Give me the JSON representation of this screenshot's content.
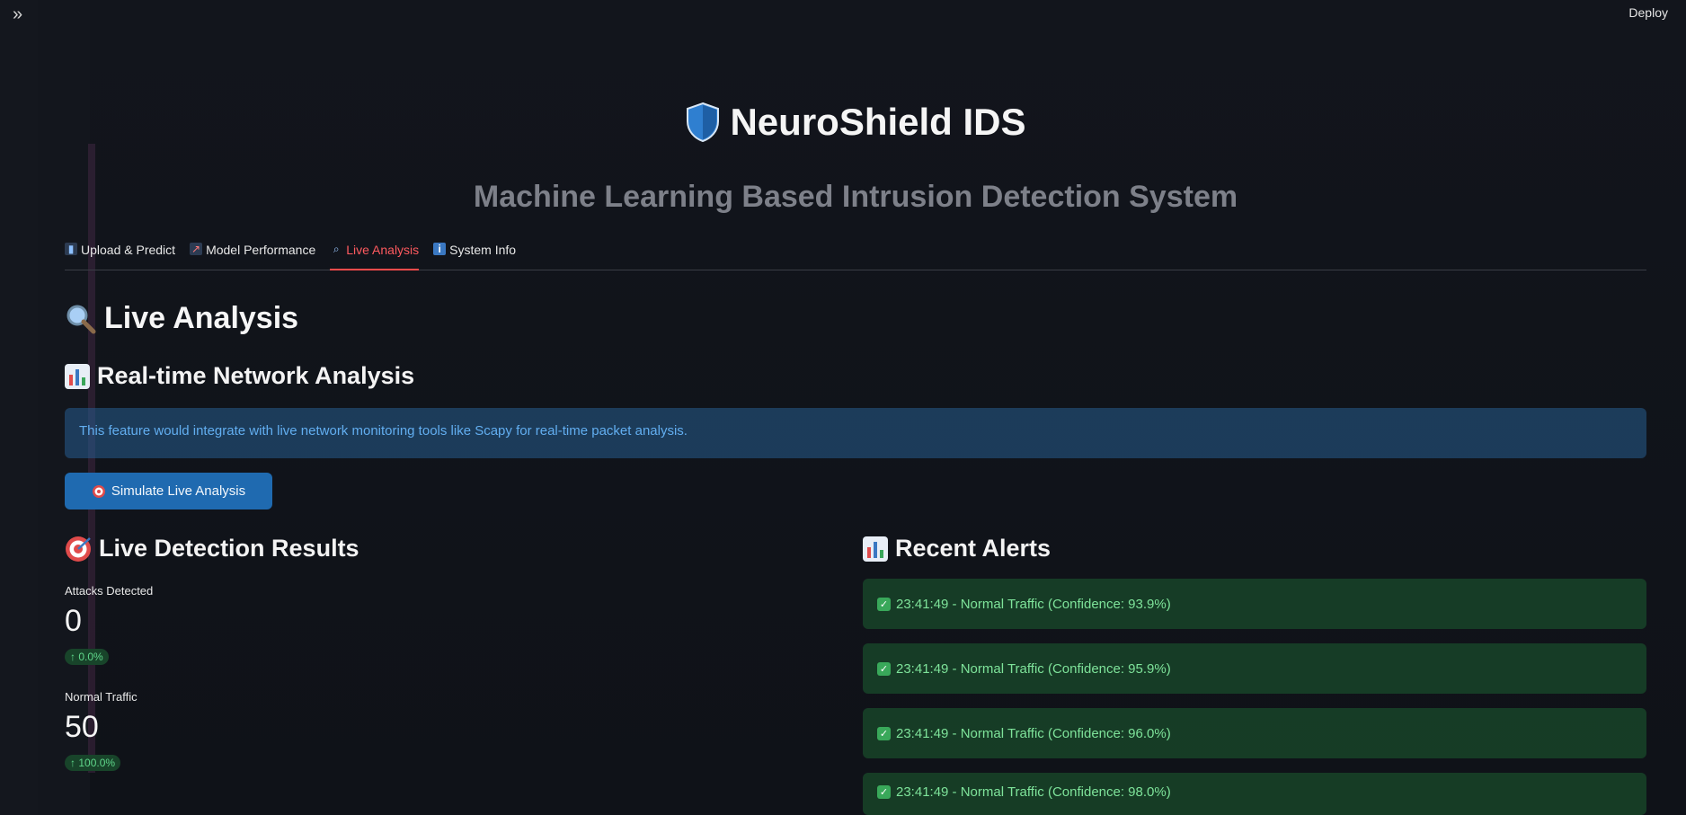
{
  "toolbar": {
    "sidebar_toggle_icon": "double-chevron-right-icon",
    "deploy_label": "Deploy"
  },
  "header": {
    "title": "NeuroShield IDS",
    "subtitle": "Machine Learning Based Intrusion Detection System",
    "title_icon": "shield-icon"
  },
  "tabs": [
    {
      "label": "Upload & Predict",
      "icon": "bar-chart-icon",
      "active": false
    },
    {
      "label": "Model Performance",
      "icon": "line-chart-icon",
      "active": false
    },
    {
      "label": "Live Analysis",
      "icon": "search-icon",
      "active": true
    },
    {
      "label": "System Info",
      "icon": "info-icon",
      "active": false
    }
  ],
  "page": {
    "heading": "Live Analysis",
    "section_realtime": "Real-time Network Analysis",
    "info_text": "This feature would integrate with live network monitoring tools like Scapy for real-time packet analysis.",
    "simulate_button": "Simulate Live Analysis"
  },
  "results": {
    "heading": "Live Detection Results",
    "metrics": [
      {
        "label": "Attacks Detected",
        "value": "0",
        "delta": "0.0%"
      },
      {
        "label": "Normal Traffic",
        "value": "50",
        "delta": "100.0%"
      }
    ]
  },
  "alerts": {
    "heading": "Recent Alerts",
    "items": [
      "23:41:49 - Normal Traffic (Confidence: 93.9%)",
      "23:41:49 - Normal Traffic (Confidence: 95.9%)",
      "23:41:49 - Normal Traffic (Confidence: 96.0%)",
      "23:41:49 - Normal Traffic (Confidence: 98.0%)"
    ]
  },
  "colors": {
    "accent": "#ff4b4b",
    "info_bg": "#1c4a74",
    "success_bg": "#1e5a30",
    "button_bg": "#1f6ab0"
  }
}
